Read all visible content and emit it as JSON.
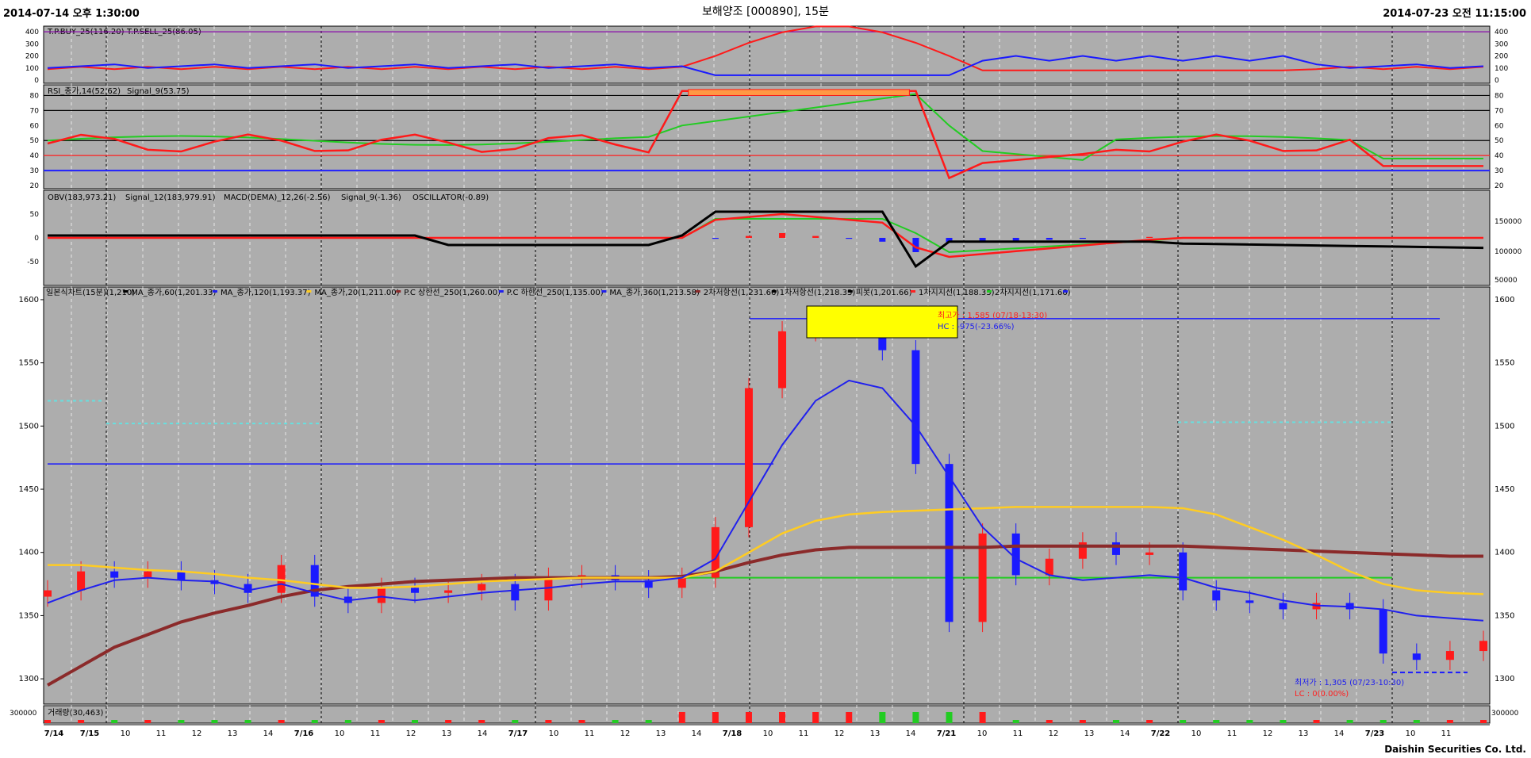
{
  "header": {
    "start": "2014-07-14 오후 1:30:00",
    "title": "보해양조 [000890], 15분",
    "end": "2014-07-23 오전 11:15:00"
  },
  "footer": {
    "brand": "Daishin Securities Co. Ltd."
  },
  "colors": {
    "panel_bg": "#adadad",
    "up": "#ff1a1a",
    "down": "#1a1aff",
    "ma60": "#2020ee",
    "ma120": "#ffcc22",
    "ma20": "#8b2a2a",
    "green": "#22cc22",
    "cyan": "#66e0e0",
    "yellow_box": "#ffff00",
    "rsi_fill": "#ff9944"
  },
  "panels": {
    "tp": {
      "legend": [
        "T.P.BUY_25(116.20)",
        "T.P.SELL_25(86.05)"
      ],
      "ticks": [
        0,
        100,
        200,
        300,
        400
      ]
    },
    "rsi": {
      "legend": [
        "RSI_종가,14(52.62)",
        "Signal_9(53.75)"
      ],
      "ticks": [
        20,
        30,
        40,
        50,
        60,
        70,
        80
      ]
    },
    "obv": {
      "legend": [
        "OBV(183,973.21)",
        "Signal_12(183,979.91)",
        "MACD(DEMA)_12,26(-2.56)",
        "Signal_9(-1.36)",
        "OSCILLATOR(-0.89)"
      ],
      "ticks_left": [
        -50,
        0,
        50
      ],
      "ticks_right": [
        "150000",
        "100000",
        "50000"
      ]
    },
    "main": {
      "legend": [
        "일본식차트(15분)(1,210)",
        "MA_종가,60(1,201.33)",
        "MA_종가,120(1,193.37)",
        "MA_종가,20(1,211.00)",
        "P.C 상한선_250(1,260.00)",
        "P.C 하한선_250(1,135.00)",
        "MA_종가,360(1,213.58)",
        "2차저항선(1,231.66)",
        "1차저항선(1,218.33)",
        "피봇(1,201.66)",
        "1차지지선(1,188.33)",
        "2차지지선(1,171.66)"
      ],
      "ticks": [
        1300,
        1350,
        1400,
        1450,
        1500,
        1550,
        1600
      ],
      "high_label": "최고가 : 1,585 (07/18-13:30)",
      "hc_label": "HC : -975(-23.66%)",
      "low_label": "최저가 : 1,305 (07/23-10:30)",
      "lc_label": "LC : 0(0.00%)"
    },
    "volume": {
      "legend": [
        "거래량(30,463)"
      ],
      "tick": "300000",
      "tick_right": "300000"
    }
  },
  "x_axis": {
    "labels": [
      "7/14",
      "7/15",
      "10",
      "11",
      "12",
      "13",
      "14",
      "7/16",
      "10",
      "11",
      "12",
      "13",
      "14",
      "7/17",
      "10",
      "11",
      "12",
      "13",
      "14",
      "7/18",
      "10",
      "11",
      "12",
      "13",
      "14",
      "7/21",
      "10",
      "11",
      "12",
      "13",
      "14",
      "7/22",
      "10",
      "11",
      "12",
      "13",
      "14",
      "7/23",
      "10",
      "11"
    ]
  },
  "chart_data": {
    "type": "candlestick",
    "title": "보해양조 [000890], 15분",
    "xlabel": "",
    "ylabel": "",
    "ylim": [
      1280,
      1610
    ],
    "x": [
      "7/14 13:30",
      "7/15 09:00",
      "7/15 10:00",
      "7/15 11:00",
      "7/15 12:00",
      "7/15 13:00",
      "7/15 14:00",
      "7/16 09:00",
      "7/16 10:00",
      "7/16 11:00",
      "7/16 12:00",
      "7/16 13:00",
      "7/16 14:00",
      "7/17 09:00",
      "7/17 10:00",
      "7/17 11:00",
      "7/17 12:00",
      "7/17 13:00",
      "7/17 14:00",
      "7/18 09:00",
      "7/18 09:30",
      "7/18 10:00",
      "7/18 11:00",
      "7/18 12:00",
      "7/18 13:00",
      "7/18 13:30",
      "7/18 14:00",
      "7/18 14:30",
      "7/21 09:00",
      "7/21 10:00",
      "7/21 11:00",
      "7/21 12:00",
      "7/21 13:00",
      "7/21 14:00",
      "7/22 09:00",
      "7/22 10:00",
      "7/22 11:00",
      "7/22 12:00",
      "7/22 13:00",
      "7/22 14:00",
      "7/23 09:00",
      "7/23 10:00",
      "7/23 10:30",
      "7/23 11:00"
    ],
    "close": [
      1370,
      1385,
      1380,
      1385,
      1378,
      1375,
      1368,
      1390,
      1365,
      1360,
      1372,
      1368,
      1370,
      1375,
      1362,
      1380,
      1382,
      1378,
      1372,
      1380,
      1420,
      1530,
      1575,
      1580,
      1582,
      1560,
      1470,
      1345,
      1415,
      1382,
      1395,
      1408,
      1398,
      1400,
      1370,
      1362,
      1360,
      1355,
      1360,
      1355,
      1320,
      1315,
      1322,
      1330
    ],
    "ma60": [
      1360,
      1370,
      1378,
      1380,
      1378,
      1377,
      1370,
      1375,
      1368,
      1362,
      1365,
      1362,
      1365,
      1368,
      1370,
      1372,
      1375,
      1377,
      1377,
      1380,
      1395,
      1440,
      1485,
      1520,
      1536,
      1530,
      1500,
      1460,
      1420,
      1395,
      1382,
      1378,
      1380,
      1382,
      1380,
      1372,
      1368,
      1362,
      1358,
      1357,
      1355,
      1350,
      1348,
      1346
    ],
    "ma120": [
      1390,
      1390,
      1388,
      1386,
      1385,
      1383,
      1380,
      1378,
      1375,
      1372,
      1372,
      1373,
      1375,
      1377,
      1378,
      1379,
      1380,
      1380,
      1380,
      1380,
      1385,
      1400,
      1415,
      1425,
      1430,
      1432,
      1433,
      1434,
      1435,
      1436,
      1436,
      1436,
      1436,
      1436,
      1435,
      1430,
      1420,
      1410,
      1398,
      1385,
      1375,
      1370,
      1368,
      1367
    ],
    "ma20": [
      1295,
      1310,
      1325,
      1335,
      1345,
      1352,
      1358,
      1365,
      1370,
      1373,
      1375,
      1377,
      1378,
      1379,
      1380,
      1380,
      1380,
      1380,
      1380,
      1381,
      1385,
      1392,
      1398,
      1402,
      1404,
      1404,
      1404,
      1404,
      1404,
      1405,
      1405,
      1405,
      1405,
      1405,
      1405,
      1404,
      1403,
      1402,
      1401,
      1400,
      1399,
      1398,
      1397,
      1397
    ],
    "pc_high": 1585,
    "pc_low": 1305,
    "high": 1585,
    "low": 1305
  }
}
